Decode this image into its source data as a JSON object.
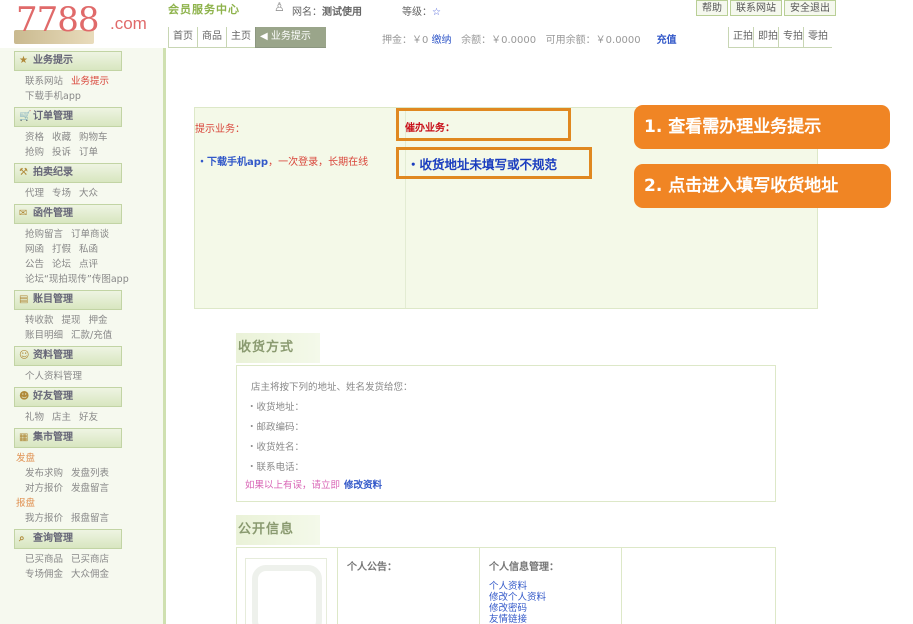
{
  "logo": {
    "brand_number": "7788",
    "brand_suffix": ".com"
  },
  "header": {
    "title": "会员服务中心",
    "user_label": "网名：",
    "user_name": "测试使用",
    "level_label": "等级：",
    "level_star": "☆",
    "top_links": [
      "帮助",
      "联系网站",
      "安全退出"
    ]
  },
  "nav": {
    "tabs": [
      "首页",
      "商品",
      "主页",
      "业务提示"
    ],
    "right_tabs": [
      "正拍",
      "即拍",
      "专拍",
      "零拍"
    ],
    "deposit_label": "押金：￥0",
    "deposit_link": "缴纳",
    "balance": "余额：￥0.0000",
    "available": "可用余额：￥0.0000",
    "recharge": "充值"
  },
  "sidebar": {
    "sections": [
      {
        "title": "业务提示",
        "icon": "star-icon",
        "rows": [
          [
            {
              "t": "联系网站"
            },
            {
              "t": "业务提示",
              "hl": true
            }
          ],
          [
            {
              "t": "下载手机app"
            }
          ]
        ]
      },
      {
        "title": "订单管理",
        "icon": "cart-icon",
        "rows": [
          [
            {
              "t": "资格"
            },
            {
              "t": "收藏"
            },
            {
              "t": "购物车"
            }
          ],
          [
            {
              "t": "抢购"
            },
            {
              "t": "投诉"
            },
            {
              "t": "订单"
            }
          ]
        ]
      },
      {
        "title": "拍卖纪录",
        "icon": "hammer-icon",
        "rows": [
          [
            {
              "t": "代理"
            },
            {
              "t": "专场"
            },
            {
              "t": "大众"
            }
          ]
        ]
      },
      {
        "title": "函件管理",
        "icon": "mail-icon",
        "rows": [
          [
            {
              "t": "抢购留言"
            },
            {
              "t": "订单商谈"
            }
          ],
          [
            {
              "t": "网函"
            },
            {
              "t": "打假"
            },
            {
              "t": "私函"
            }
          ],
          [
            {
              "t": "公告"
            },
            {
              "t": "论坛"
            },
            {
              "t": "点评"
            }
          ],
          [
            {
              "t": "论坛“现拍现传”传图app"
            }
          ]
        ]
      },
      {
        "title": "账目管理",
        "icon": "ledger-icon",
        "rows": [
          [
            {
              "t": "转收款"
            },
            {
              "t": "提现"
            },
            {
              "t": "押金"
            }
          ],
          [
            {
              "t": "账目明细"
            },
            {
              "t": "汇款/充值"
            }
          ]
        ]
      },
      {
        "title": "资料管理",
        "icon": "profile-icon",
        "rows": [
          [
            {
              "t": "个人资料管理"
            }
          ]
        ]
      },
      {
        "title": "好友管理",
        "icon": "friends-icon",
        "rows": [
          [
            {
              "t": "礼物"
            },
            {
              "t": "店主"
            },
            {
              "t": "好友"
            }
          ]
        ]
      },
      {
        "title": "集市管理",
        "icon": "market-icon",
        "rows": [
          [
            {
              "t": "发盘",
              "sub": true
            }
          ],
          [
            {
              "t": "发布求购"
            },
            {
              "t": "发盘列表"
            }
          ],
          [
            {
              "t": "对方报价"
            },
            {
              "t": "发盘留言"
            }
          ],
          [
            {
              "t": "报盘",
              "sub": true
            }
          ],
          [
            {
              "t": "我方报价"
            },
            {
              "t": "报盘留言"
            }
          ]
        ]
      },
      {
        "title": "查询管理",
        "icon": "search-icon",
        "rows": [
          [
            {
              "t": "已买商品"
            },
            {
              "t": "已买商店"
            }
          ],
          [
            {
              "t": "专场佣金"
            },
            {
              "t": "大众佣金"
            }
          ]
        ]
      }
    ]
  },
  "tips": {
    "label": "提示业务：",
    "download_bold": "・下载手机app",
    "download_rest": "，一次登录，长期在线",
    "urgent_label": "催办业务：",
    "address_warning": "・收货地址未填写或不规范"
  },
  "callouts": {
    "step1": "1. 查看需办理业务提示",
    "step2": "2. 点击进入填写收货地址"
  },
  "shipping": {
    "title": "收货方式",
    "intro": "店主将按下列的地址、姓名发货给您：",
    "address": "・收货地址：",
    "zip": "・邮政编码：",
    "name": "・收货姓名：",
    "phone": "・联系电话：",
    "edit_prefix": "如果以上有误，请立即",
    "edit_link": "修改资料"
  },
  "public_info": {
    "title": "公开信息",
    "announcement": "个人公告：",
    "info_manage": "个人信息管理：",
    "links": [
      "个人资料",
      "修改个人资料",
      "修改密码",
      "友情链接"
    ]
  }
}
